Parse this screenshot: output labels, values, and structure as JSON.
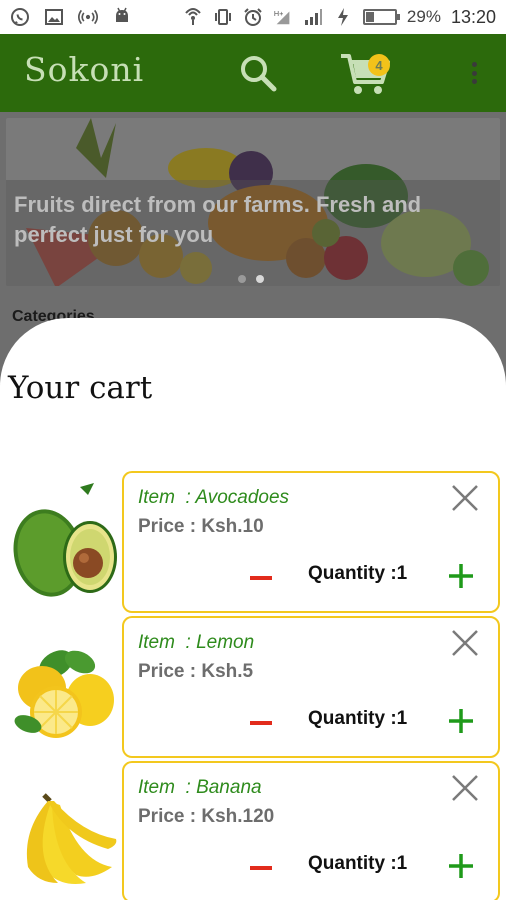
{
  "status_bar": {
    "battery_percent": "29%",
    "battery_level": 0.29,
    "time": "13:20"
  },
  "app_bar": {
    "title": "Sokoni",
    "cart_count": "4",
    "accent_color": "#2c6a0c",
    "badge_color": "#f2c21a"
  },
  "background_page": {
    "banner_text": "Fruits direct from our farms. Fresh and perfect just for you",
    "categories_heading": "Categories"
  },
  "cart_sheet": {
    "title": "Your cart",
    "items": [
      {
        "name": "Item  : Avocadoes",
        "price": "Price : Ksh.10",
        "quantity": "Quantity :1",
        "image_icon": "avocado-icon"
      },
      {
        "name": "Item  : Lemon",
        "price": "Price : Ksh.5",
        "quantity": "Quantity :1",
        "image_icon": "lemon-icon"
      },
      {
        "name": "Item  : Banana",
        "price": "Price : Ksh.120",
        "quantity": "Quantity :1",
        "image_icon": "banana-icon"
      }
    ]
  }
}
